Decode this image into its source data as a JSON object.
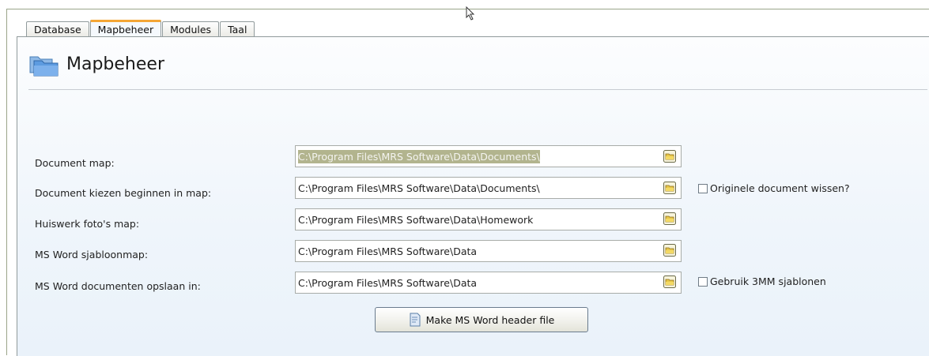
{
  "tabs": [
    {
      "label": "Database",
      "active": false
    },
    {
      "label": "Mapbeheer",
      "active": true
    },
    {
      "label": "Modules",
      "active": false
    },
    {
      "label": "Taal",
      "active": false
    }
  ],
  "page": {
    "title": "Mapbeheer",
    "icon": "folders-icon"
  },
  "fields": [
    {
      "label": "Document map:",
      "value": "C:\\Program Files\\MRS Software\\Data\\Documents\\",
      "selected": true
    },
    {
      "label": "Document kiezen beginnen in map:",
      "value": "C:\\Program Files\\MRS Software\\Data\\Documents\\",
      "selected": false
    },
    {
      "label": "Huiswerk foto's map:",
      "value": "C:\\Program Files\\MRS Software\\Data\\Homework",
      "selected": false
    },
    {
      "label": "MS Word sjabloonmap:",
      "value": "C:\\Program Files\\MRS Software\\Data",
      "selected": false
    },
    {
      "label": "MS Word documenten opslaan in:",
      "value": "C:\\Program Files\\MRS Software\\Data",
      "selected": false
    }
  ],
  "checkboxes": {
    "delete_original": {
      "label": "Originele document wissen?",
      "checked": false
    },
    "use_3mm": {
      "label": "Gebruik 3MM sjablonen",
      "checked": false
    }
  },
  "make_button": {
    "label": "Make MS Word header file",
    "icon": "document-icon"
  },
  "colors": {
    "active_tab_accent": "#f4a636",
    "panel_background": "#eff5fb",
    "selection_highlight": "#b2b48e"
  }
}
